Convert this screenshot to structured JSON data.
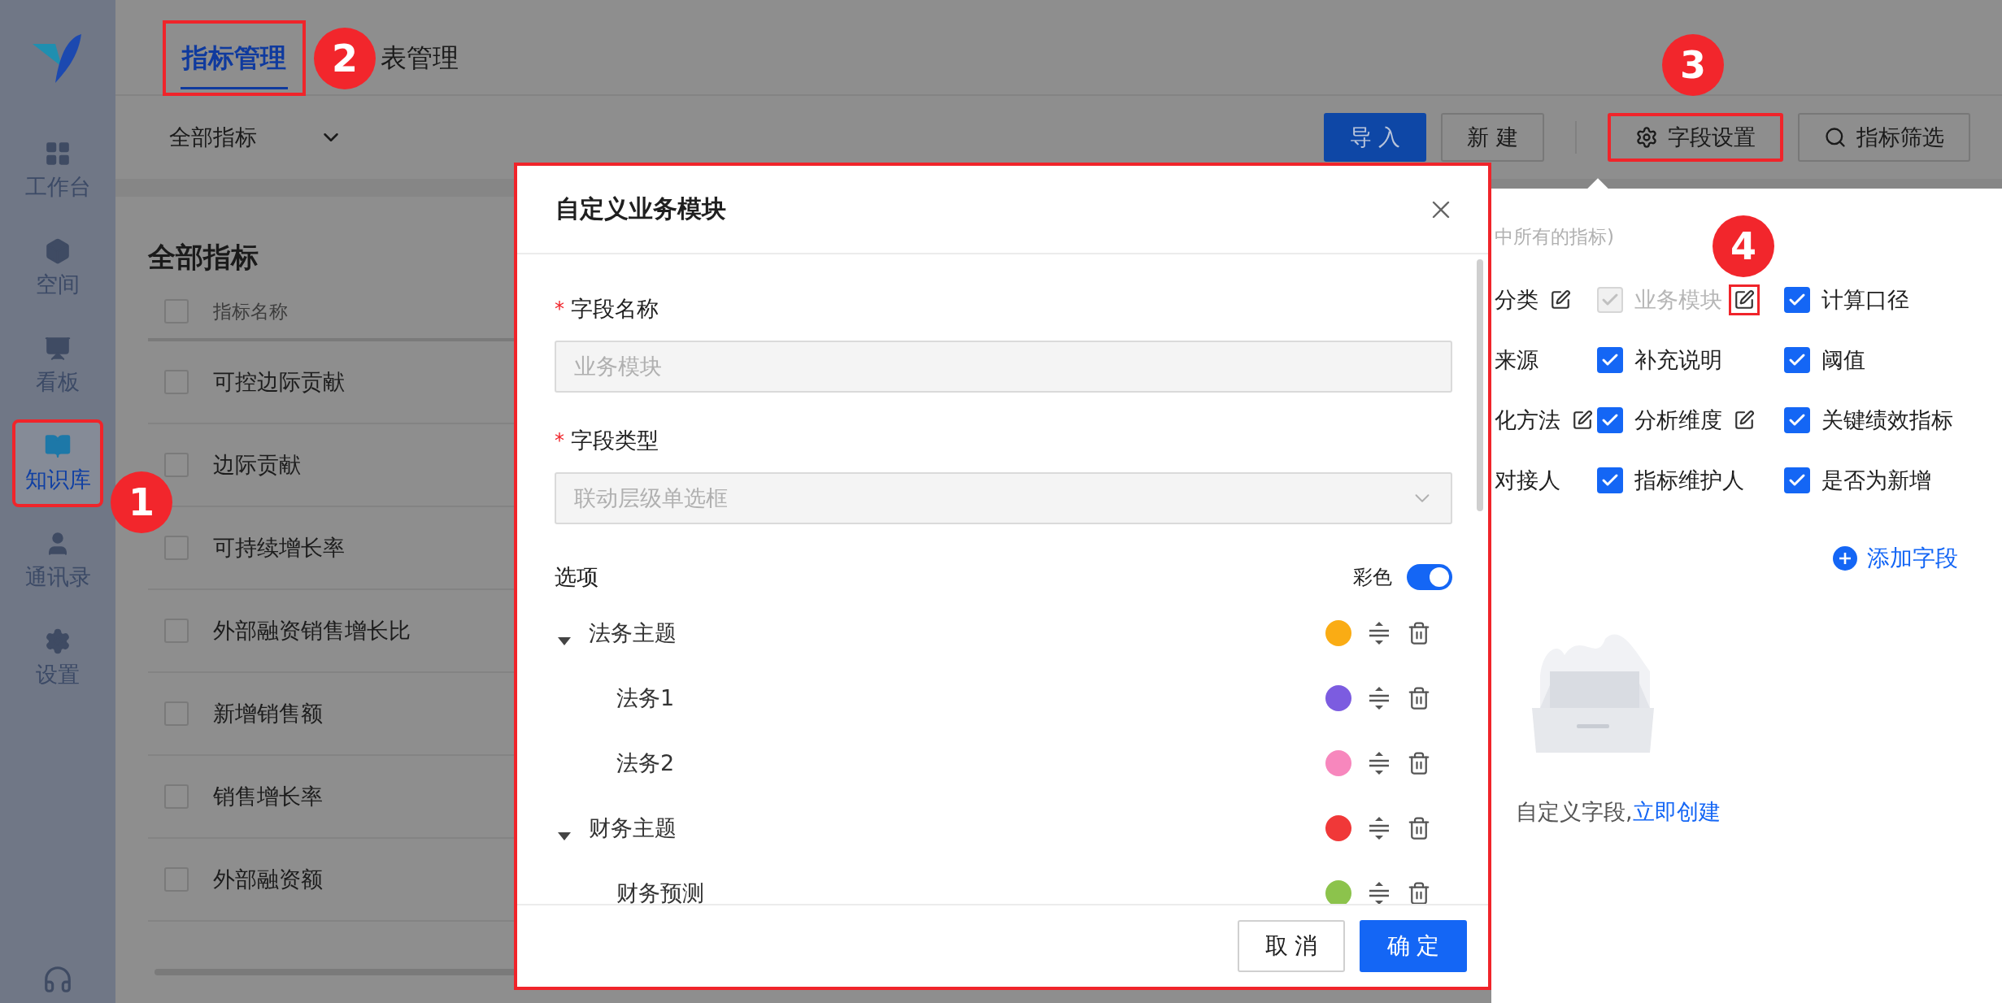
{
  "sidebar": {
    "items": [
      {
        "label": "工作台",
        "selected": false,
        "highlighted": false
      },
      {
        "label": "空间",
        "selected": false,
        "highlighted": false
      },
      {
        "label": "看板",
        "selected": false,
        "highlighted": false
      },
      {
        "label": "知识库",
        "selected": true,
        "highlighted": true
      },
      {
        "label": "通讯录",
        "selected": false,
        "highlighted": false
      },
      {
        "label": "设置",
        "selected": false,
        "highlighted": false
      }
    ]
  },
  "tabs": [
    {
      "label": "指标管理",
      "selected": true,
      "highlighted": true
    },
    {
      "label": "表管理",
      "selected": false,
      "highlighted": false
    }
  ],
  "toolbar": {
    "filter": "全部指标",
    "buttons": [
      {
        "label": "导 入",
        "kind": "primary",
        "highlighted": false
      },
      {
        "label": "新 建",
        "kind": "default",
        "highlighted": false
      },
      {
        "label": "字段设置",
        "kind": "settings",
        "highlighted": true
      },
      {
        "label": "指标筛选",
        "kind": "search",
        "highlighted": false
      }
    ]
  },
  "list": {
    "title": "全部指标",
    "column": "指标名称",
    "header_checked": false,
    "rows": [
      {
        "name": "可控边际贡献",
        "checked": false
      },
      {
        "name": "边际贡献",
        "checked": false
      },
      {
        "name": "可持续增长率",
        "checked": false
      },
      {
        "name": "外部融资销售增长比",
        "checked": false
      },
      {
        "name": "新增销售额",
        "checked": false
      },
      {
        "name": "销售增长率",
        "checked": false
      },
      {
        "name": "外部融资额",
        "checked": false
      }
    ]
  },
  "field_panel": {
    "note": "中所有的指标)",
    "fields": [
      {
        "kind": "cut",
        "label": "分类",
        "editable": true,
        "highlighted": false
      },
      {
        "kind": "checkbox",
        "label": "业务模块",
        "checked": true,
        "disabled": true,
        "editable": true,
        "highlighted": true
      },
      {
        "kind": "checkbox",
        "label": "计算口径",
        "checked": true,
        "disabled": false,
        "editable": false,
        "highlighted": false
      },
      {
        "kind": "cut",
        "label": "来源",
        "editable": false,
        "highlighted": false
      },
      {
        "kind": "checkbox",
        "label": "补充说明",
        "checked": true,
        "disabled": false,
        "editable": false,
        "highlighted": false
      },
      {
        "kind": "checkbox",
        "label": "阈值",
        "checked": true,
        "disabled": false,
        "editable": false,
        "highlighted": false
      },
      {
        "kind": "cut",
        "label": "化方法",
        "editable": true,
        "highlighted": false
      },
      {
        "kind": "checkbox",
        "label": "分析维度",
        "checked": true,
        "disabled": false,
        "editable": true,
        "highlighted": false
      },
      {
        "kind": "checkbox",
        "label": "关键绩效指标",
        "checked": true,
        "disabled": false,
        "editable": false,
        "highlighted": false
      },
      {
        "kind": "cut",
        "label": "对接人",
        "editable": false,
        "highlighted": false
      },
      {
        "kind": "checkbox",
        "label": "指标维护人",
        "checked": true,
        "disabled": false,
        "editable": false,
        "highlighted": false
      },
      {
        "kind": "checkbox",
        "label": "是否为新增",
        "checked": true,
        "disabled": false,
        "editable": false,
        "highlighted": false
      }
    ],
    "add_field": "添加字段",
    "empty_text": "自定义字段,",
    "empty_link": "立即创建"
  },
  "dialog": {
    "title": "自定义业务模块",
    "highlighted": true,
    "fields": [
      {
        "label": "字段名称",
        "required_mark": "*",
        "kind": "input",
        "value": "业务模块"
      },
      {
        "label": "字段类型",
        "required_mark": "*",
        "kind": "select",
        "value": "联动层级单选框"
      }
    ],
    "options_label": "选项",
    "color_toggle": {
      "label": "彩色",
      "on": true
    },
    "options": [
      {
        "label": "法务主题",
        "color": "#faac14",
        "expanded": true,
        "children": [
          {
            "label": "法务1",
            "color": "#7c5ce0"
          },
          {
            "label": "法务2",
            "color": "#f787bd"
          }
        ]
      },
      {
        "label": "财务主题",
        "color": "#f03838",
        "expanded": true,
        "children": [
          {
            "label": "财务预测",
            "color": "#8cc34c"
          }
        ]
      }
    ],
    "buttons": [
      {
        "label": "取 消",
        "kind": "default"
      },
      {
        "label": "确 定",
        "kind": "primary"
      }
    ]
  },
  "annotations": [
    {
      "label": "1"
    },
    {
      "label": "2"
    },
    {
      "label": "3"
    },
    {
      "label": "4"
    }
  ]
}
